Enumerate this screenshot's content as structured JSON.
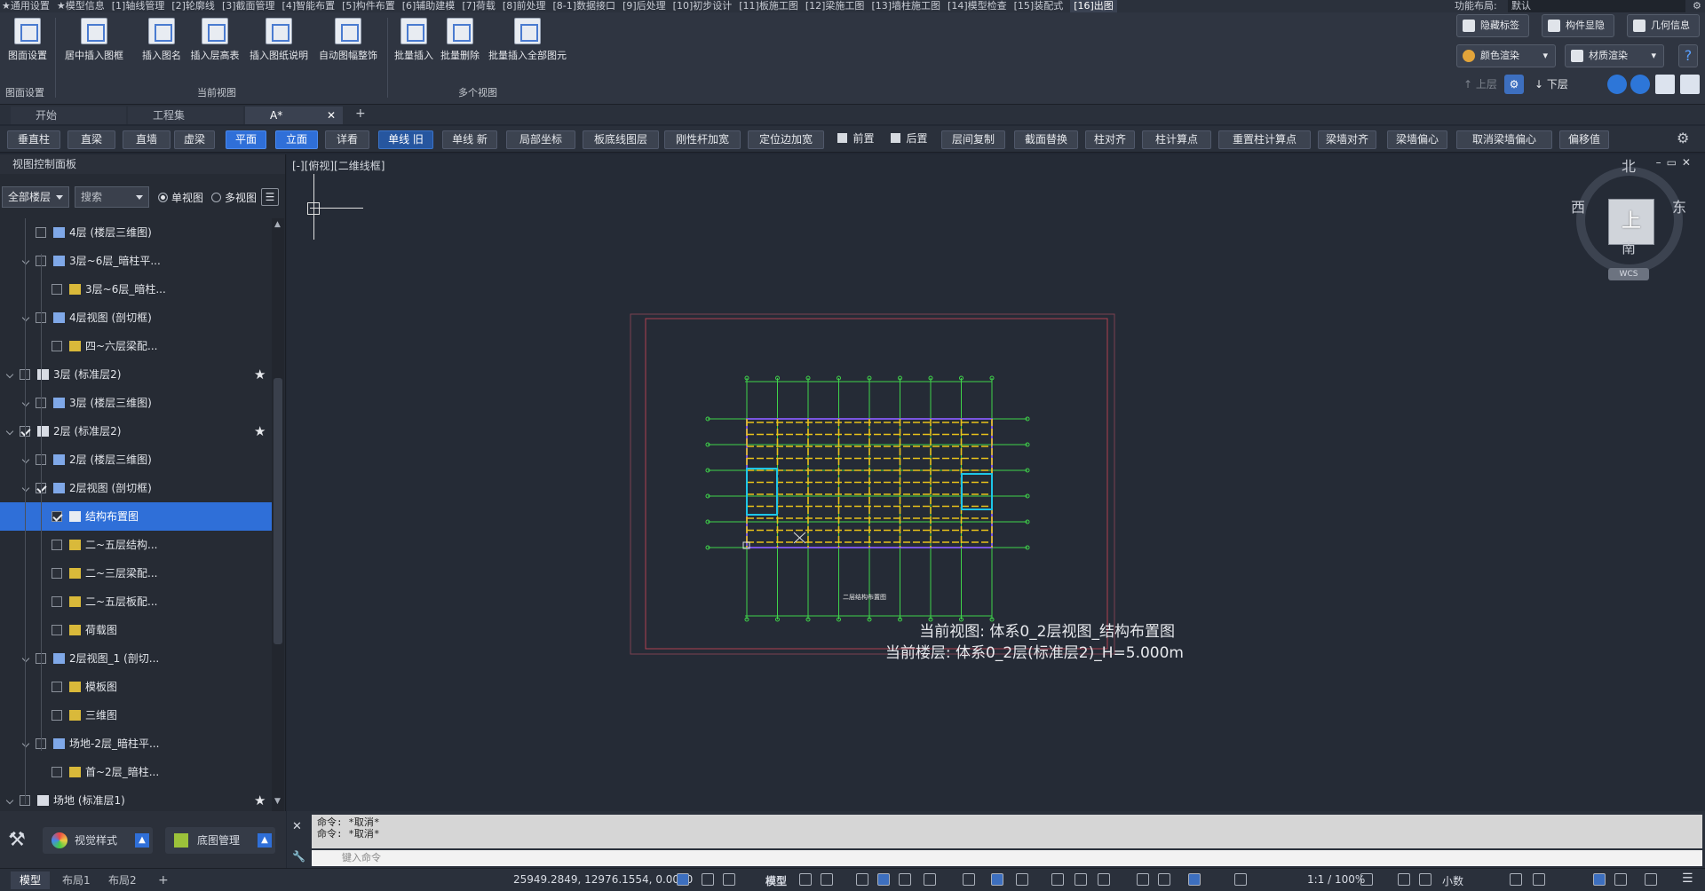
{
  "menubar": {
    "items": [
      "★通用设置",
      "★模型信息",
      "[1]轴线管理",
      "[2]轮廓线",
      "[3]截面管理",
      "[4]智能布置",
      "[5]构件布置",
      "[6]辅助建模",
      "[7]荷载",
      "[8]前处理",
      "[8-1]数据接口",
      "[9]后处理",
      "[10]初步设计",
      "[11]板施工图",
      "[12]梁施工图",
      "[13]墙柱施工图",
      "[14]模型检查",
      "[15]装配式",
      "[16]出图"
    ],
    "layout_label": "功能布局:",
    "layout_value": "默认"
  },
  "ribbon": {
    "buttons": [
      "图面设置",
      "居中插入图框",
      "插入图名",
      "插入层高表",
      "插入图纸说明",
      "自动图幅整饰",
      "批量插入",
      "批量删除",
      "批量插入全部图元"
    ],
    "groups": [
      "图面设置",
      "当前视图",
      "多个视图"
    ],
    "right": {
      "hide_label": "隐藏标签",
      "component_display": "构件显隐",
      "geometry_info": "几何信息",
      "color_render": "颜色渲染",
      "material_render": "材质渲染",
      "up_floor": "上层",
      "down_floor": "下层",
      "help": "?"
    }
  },
  "tabs": [
    "开始",
    "工程集",
    "A*"
  ],
  "toolbar": {
    "buttons": [
      "垂直柱",
      "直梁",
      "直墙",
      "虚梁",
      "平面",
      "立面",
      "详看",
      "单线 旧",
      "单线 新",
      "局部坐标",
      "板底线图层",
      "刚性杆加宽",
      "定位边加宽",
      "前置",
      "后置",
      "层间复制",
      "截面替换",
      "柱对齐",
      "柱计算点",
      "重置柱计算点",
      "梁墙对齐",
      "梁墙偏心",
      "取消梁墙偏心",
      "偏移值"
    ]
  },
  "left_panel": {
    "title": "视图控制面板",
    "floor_select": "全部楼层",
    "search_placeholder": "搜索",
    "single_view": "单视图",
    "multi_view": "多视图",
    "tree": [
      {
        "label": "4层 (楼层三维图)",
        "level": 2,
        "checked": false
      },
      {
        "label": "3层~6层_暗柱平...",
        "level": 2,
        "checked": false
      },
      {
        "label": "3层~6层_暗柱...",
        "level": 3,
        "checked": false
      },
      {
        "label": "4层视图 (剖切框)",
        "level": 2,
        "checked": false
      },
      {
        "label": "四~六层梁配...",
        "level": 3,
        "checked": false
      },
      {
        "label": "3层 (标准层2)",
        "level": 1,
        "checked": false
      },
      {
        "label": "3层 (楼层三维图)",
        "level": 2,
        "checked": false
      },
      {
        "label": "2层 (标准层2)",
        "level": 1,
        "checked": true
      },
      {
        "label": "2层 (楼层三维图)",
        "level": 2,
        "checked": false
      },
      {
        "label": "2层视图 (剖切框)",
        "level": 2,
        "checked": true
      },
      {
        "label": "结构布置图",
        "level": 3,
        "checked": true,
        "selected": true
      },
      {
        "label": "二~五层结构...",
        "level": 3,
        "checked": false
      },
      {
        "label": "二~三层梁配...",
        "level": 3,
        "checked": false
      },
      {
        "label": "二~五层板配...",
        "level": 3,
        "checked": false
      },
      {
        "label": "荷载图",
        "level": 3,
        "checked": false
      },
      {
        "label": "2层视图_1 (剖切...",
        "level": 2,
        "checked": false
      },
      {
        "label": "模板图",
        "level": 3,
        "checked": false
      },
      {
        "label": "三维图",
        "level": 3,
        "checked": false
      },
      {
        "label": "场地-2层_暗柱平...",
        "level": 2,
        "checked": false
      },
      {
        "label": "首~2层_暗柱...",
        "level": 3,
        "checked": false
      },
      {
        "label": "场地 (标准层1)",
        "level": 1,
        "checked": false
      }
    ],
    "bottom": {
      "visual_style": "视觉样式",
      "base_map": "底图管理"
    }
  },
  "canvas": {
    "view_label": "[-][俯视][二维线框]",
    "current_view": "当前视图: 体系0_2层视图_结构布置图",
    "current_floor": "当前楼层: 体系0_2层(标准层2)_H=5.000m",
    "drawing_title": "二层结构布置图",
    "compass": {
      "north": "北",
      "south": "南",
      "east": "东",
      "west": "西",
      "top": "上",
      "wcs": "WCS"
    }
  },
  "command": {
    "history": [
      "命令: *取消*",
      "命令: *取消*"
    ],
    "placeholder": "键入命令"
  },
  "status": {
    "tabs": [
      "模型",
      "布局1",
      "布局2"
    ],
    "coords": "25949.2849, 12976.1554, 0.0000",
    "mode": "模型",
    "scale": "1:1 / 100%",
    "unit": "小数"
  },
  "colors": {
    "accent": "#2f6fd8",
    "canvas_bg": "#252b36",
    "panel_bg": "#262b34",
    "grid_yellow": "#e8c21a",
    "axis_green": "#3fd34a",
    "frame_red": "#b04050"
  }
}
